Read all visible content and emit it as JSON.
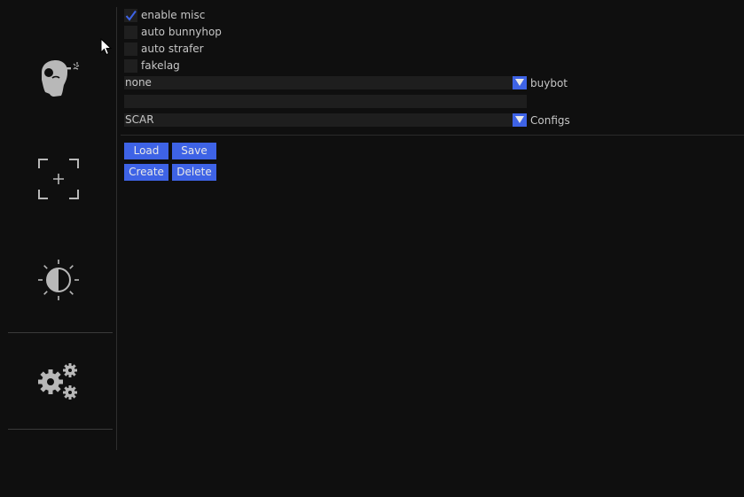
{
  "colors": {
    "background": "#0f0f0f",
    "accent": "#3e63e6",
    "field": "#1e1e1e",
    "text": "#c6c6c6",
    "icon": "#b8b8b8"
  },
  "sidebar": {
    "tabs": [
      {
        "icon": "head-aim-icon",
        "active": false
      },
      {
        "icon": "crosshair-icon",
        "active": false
      },
      {
        "icon": "brightness-icon",
        "active": false
      },
      {
        "icon": "gears-icon",
        "active": true
      }
    ]
  },
  "misc": {
    "checkboxes": [
      {
        "label": "enable misc",
        "checked": true
      },
      {
        "label": "auto bunnyhop",
        "checked": false
      },
      {
        "label": "auto strafer",
        "checked": false
      },
      {
        "label": "fakelag",
        "checked": false
      }
    ],
    "buybot": {
      "value": "none",
      "caption": "buybot"
    },
    "config_name": {
      "value": "",
      "placeholder": ""
    },
    "configs": {
      "value": "SCAR",
      "caption": "Configs"
    },
    "buttons": {
      "load": "Load",
      "save": "Save",
      "create": "Create",
      "delete": "Delete"
    }
  }
}
